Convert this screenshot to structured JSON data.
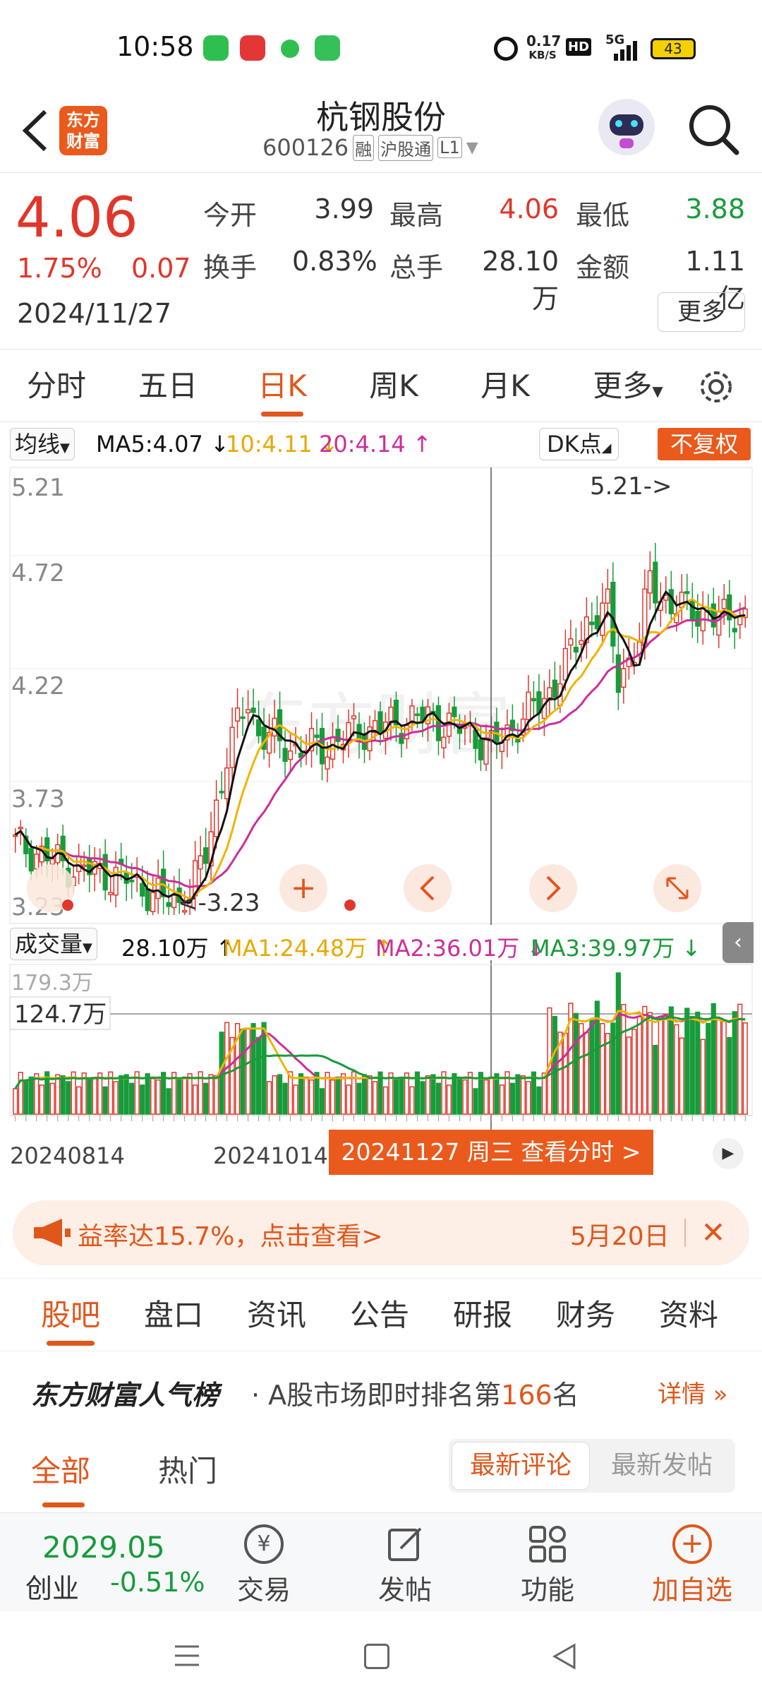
{
  "status": {
    "time": "10:58",
    "net_speed_top": "0.17",
    "net_speed_bottom": "KB/S",
    "hd": "HD",
    "signal": "5G",
    "battery": "43"
  },
  "header": {
    "logo_line1": "东方",
    "logo_line2": "财富",
    "stock_name": "杭钢股份",
    "stock_code": "600126",
    "tags": [
      "融",
      "沪股通",
      "L1"
    ]
  },
  "quote": {
    "price": "4.06",
    "change_pct": "1.75%",
    "change_amt": "0.07",
    "date": "2024/11/27",
    "fields": [
      {
        "label": "今开",
        "value": "3.99",
        "color": "dark"
      },
      {
        "label": "最高",
        "value": "4.06",
        "color": "red"
      },
      {
        "label": "最低",
        "value": "3.88",
        "color": "green"
      },
      {
        "label": "换手",
        "value": "0.83%",
        "color": "dark"
      },
      {
        "label": "总手",
        "value": "28.10万",
        "color": "dark"
      },
      {
        "label": "金额",
        "value": "1.11亿",
        "color": "dark"
      }
    ],
    "more_button": "更多"
  },
  "kline_tabs": {
    "tabs": [
      "分时",
      "五日",
      "日K",
      "周K",
      "月K",
      "更多"
    ],
    "active": "日K"
  },
  "ma_bar": {
    "selector": "均线",
    "ma5": "MA5:4.07",
    "ma10": "10:4.11",
    "ma20": "20:4.14",
    "dk_button": "DK点",
    "fq_button": "不复权"
  },
  "price_axis": [
    "5.21",
    "4.72",
    "4.22",
    "3.73",
    "3.23"
  ],
  "annotations": {
    "high": "5.21",
    "low": "3.23"
  },
  "volume_bar": {
    "selector": "成交量",
    "vol": "28.10万",
    "ma1": "MA1:24.48万",
    "ma2": "MA2:36.01万",
    "ma3": "MA3:39.97万"
  },
  "volume_axis": {
    "top": "179.3万",
    "crosshair": "124.7万"
  },
  "date_axis": {
    "start": "20240814",
    "mid": "20241014",
    "selected": "20241127 周三 查看分时 >"
  },
  "chart_data": {
    "type": "candlestick",
    "ylim": [
      3.23,
      5.21
    ],
    "note_colors": {
      "ma5": "#111111",
      "ma10": "#f0b400",
      "ma20": "#cc2e9a",
      "up": "#e0362b",
      "down": "#179c3a"
    }
  },
  "banner": {
    "text": "益率达15.7%，点击查看>",
    "date": "5月20日"
  },
  "main_tabs": {
    "tabs": [
      "股吧",
      "盘口",
      "资讯",
      "公告",
      "研报",
      "财务",
      "资料"
    ],
    "active": "股吧"
  },
  "rank": {
    "title": "东方财富人气榜",
    "text_before": "A股市场即时排名第",
    "rank_num": "166",
    "text_after": "名",
    "detail": "详情"
  },
  "subtabs": {
    "all": "全部",
    "hot": "热门",
    "latest_comment": "最新评论",
    "latest_post": "最新发帖"
  },
  "bottom_bar": {
    "index_value": "2029.05",
    "index_name": "创业",
    "index_change": "-0.51%",
    "items": [
      "交易",
      "发帖",
      "功能",
      "加自选"
    ]
  }
}
